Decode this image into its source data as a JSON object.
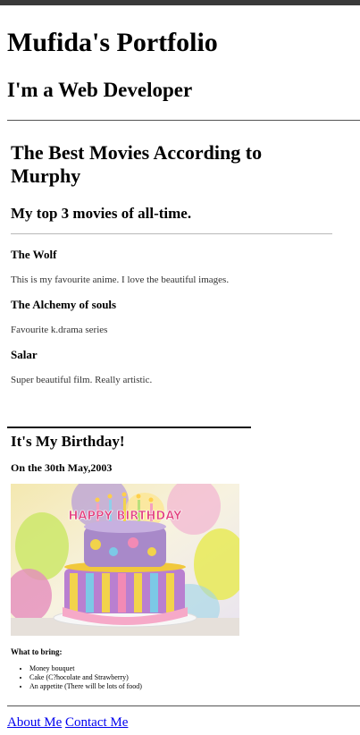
{
  "header": {
    "title": "Mufida's Portfolio",
    "subtitle": "I'm a Web Developer"
  },
  "movies": {
    "heading": "The Best Movies According to Murphy",
    "subheading": "My top 3 movies of all-time.",
    "items": [
      {
        "title": "The Wolf",
        "description": "This is my favourite anime. I love the beautiful images."
      },
      {
        "title": "The Alchemy of souls",
        "description": "Favourite k.drama series"
      },
      {
        "title": "Salar",
        "description": "Super beautiful film. Really artistic."
      }
    ]
  },
  "birthday": {
    "heading": "It's My Birthday!",
    "date": "On the 30th May,2003",
    "cake_topper": "HAPPY BIRTHDAY",
    "bring_label": "What to bring:",
    "bring_items": [
      "Money bouquet",
      "Cake (C?hocolate and Strawberry)",
      "An appetite (There will be lots of food)"
    ]
  },
  "footer": {
    "links": [
      "About Me",
      "Contact Me"
    ]
  }
}
